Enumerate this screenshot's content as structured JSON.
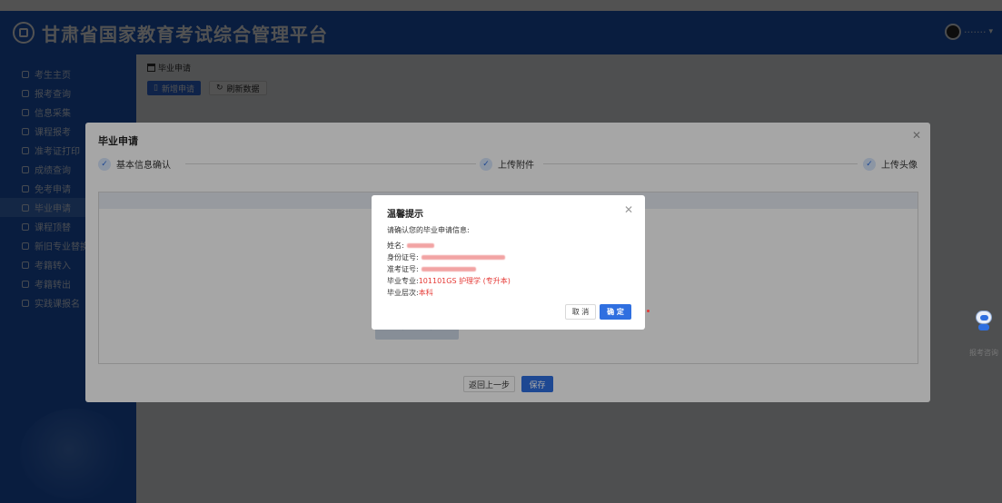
{
  "app": {
    "title": "甘肃省国家教育考试综合管理平台",
    "user_name": "·······"
  },
  "sidebar": {
    "items": [
      {
        "label": "考生主页"
      },
      {
        "label": "报考查询"
      },
      {
        "label": "信息采集"
      },
      {
        "label": "课程报考"
      },
      {
        "label": "准考证打印"
      },
      {
        "label": "成绩查询"
      },
      {
        "label": "免考申请"
      },
      {
        "label": "毕业申请"
      },
      {
        "label": "课程顶替"
      },
      {
        "label": "新旧专业替换"
      },
      {
        "label": "考籍转入"
      },
      {
        "label": "考籍转出"
      },
      {
        "label": "实践课报名"
      }
    ],
    "active_index": 7
  },
  "page": {
    "breadcrumb": "毕业申请",
    "new_button": "新增申请",
    "refresh_button": "刷新数据"
  },
  "dialog": {
    "title": "毕业申请",
    "steps": [
      {
        "label": "基本信息确认"
      },
      {
        "label": "上传附件"
      },
      {
        "label": "上传头像"
      }
    ],
    "back_button": "返回上一步",
    "save_button": "保存"
  },
  "confirm": {
    "title": "温馨提示",
    "intro": "请确认您的毕业申请信息:",
    "name_label": "姓名:",
    "id_label": "身份证号:",
    "admission_label": "准考证号:",
    "major_label": "毕业专业:",
    "major_value": "101101GS 护理学 (专升本)",
    "level_label": "毕业层次:",
    "level_value": "本科",
    "cancel_button": "取 消",
    "ok_button": "确 定"
  },
  "assistant": {
    "label": "报考咨询"
  },
  "colors": {
    "primary": "#1d5bc4",
    "button": "#2f6fe0",
    "highlight_text": "#e53935"
  }
}
